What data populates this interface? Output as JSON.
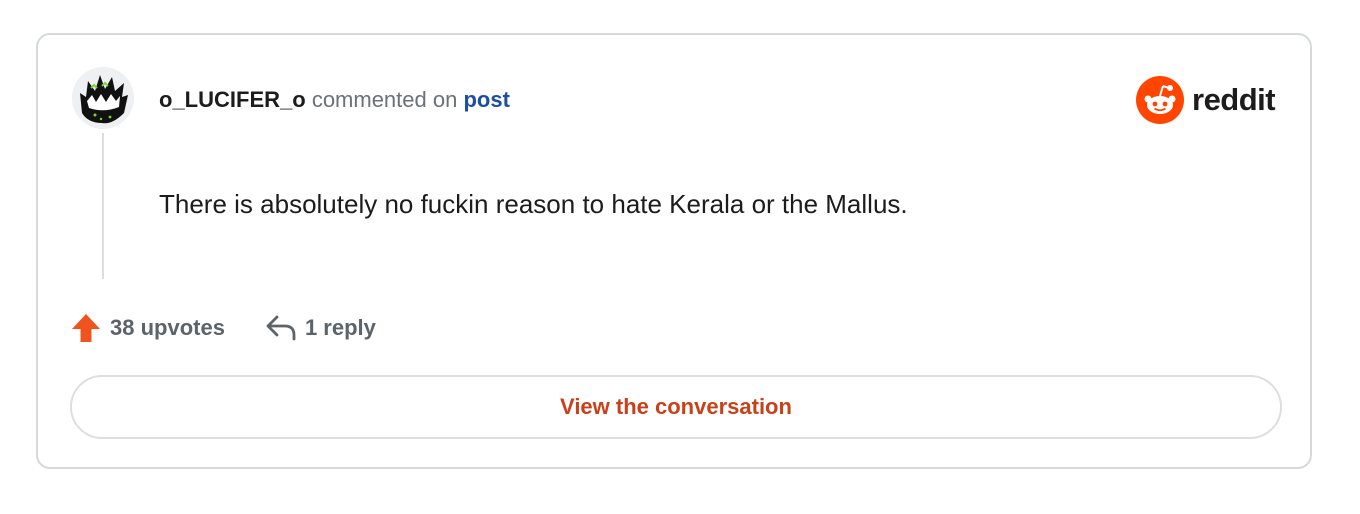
{
  "comment": {
    "username": "o_LUCIFER_o",
    "action_text": "commented on",
    "target_link": "post",
    "body": "There is absolutely no fuckin reason to hate Kerala or the Mallus."
  },
  "brand": {
    "name": "reddit",
    "icon": "reddit-logo-icon",
    "color": "#ff4500"
  },
  "stats": {
    "upvotes_label": "38 upvotes",
    "upvote_icon": "upvote-arrow-icon",
    "upvote_color": "#f0541e",
    "replies_label": "1 reply",
    "reply_icon": "reply-arrow-icon"
  },
  "cta": {
    "label": "View the conversation",
    "color": "#c8411a"
  }
}
